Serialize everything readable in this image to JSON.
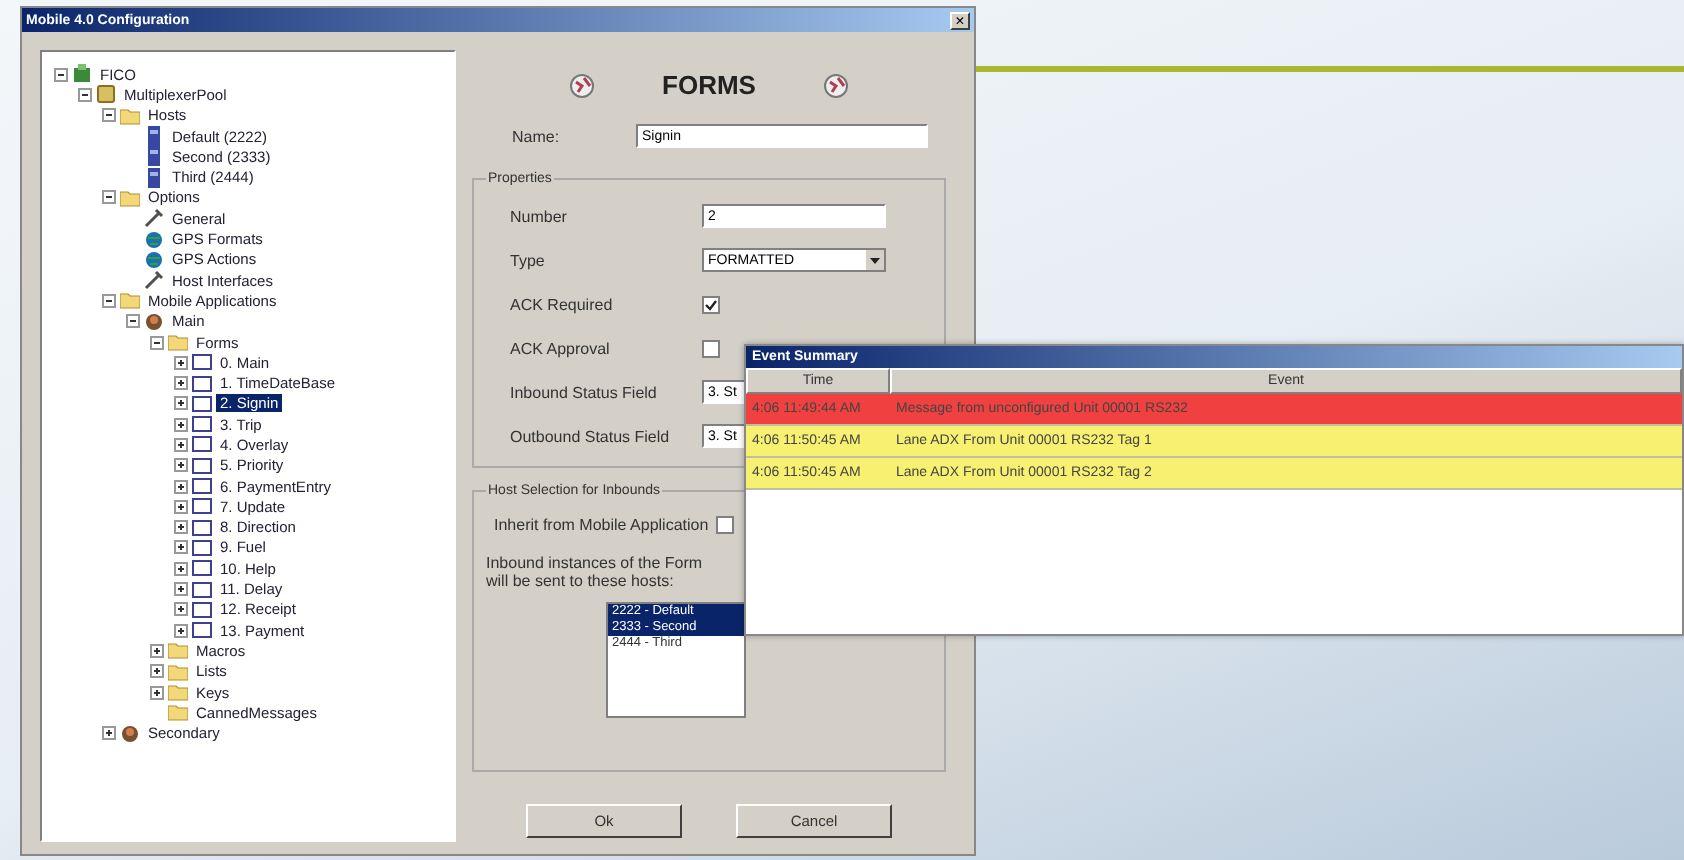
{
  "window": {
    "title": "Mobile 4.0 Configuration",
    "close": "×"
  },
  "tree": [
    {
      "label": "FICO",
      "kind": "root",
      "expanded": true,
      "selected": false,
      "children": [
        {
          "label": "MultiplexerPool",
          "kind": "pool",
          "expanded": true,
          "selected": false,
          "children": [
            {
              "label": "Hosts",
              "kind": "folder",
              "expanded": true,
              "selected": false,
              "children": [
                {
                  "label": "Default (2222)",
                  "kind": "host",
                  "selected": false
                },
                {
                  "label": "Second (2333)",
                  "kind": "host",
                  "selected": false
                },
                {
                  "label": "Third (2444)",
                  "kind": "host",
                  "selected": false
                }
              ]
            },
            {
              "label": "Options",
              "kind": "folder",
              "expanded": true,
              "selected": false,
              "children": [
                {
                  "label": "General",
                  "kind": "tool",
                  "selected": false
                },
                {
                  "label": "GPS Formats",
                  "kind": "gps",
                  "selected": false
                },
                {
                  "label": "GPS Actions",
                  "kind": "gps",
                  "selected": false
                },
                {
                  "label": "Host Interfaces",
                  "kind": "tool",
                  "selected": false
                }
              ]
            },
            {
              "label": "Mobile Applications",
              "kind": "folder",
              "expanded": true,
              "selected": false,
              "children": [
                {
                  "label": "Main",
                  "kind": "app",
                  "expanded": true,
                  "selected": false,
                  "children": [
                    {
                      "label": "Forms",
                      "kind": "folder",
                      "expanded": true,
                      "selected": false,
                      "children": [
                        {
                          "label": "0. Main",
                          "kind": "form",
                          "expanded": false,
                          "selected": false
                        },
                        {
                          "label": "1. TimeDateBase",
                          "kind": "form",
                          "expanded": false,
                          "selected": false
                        },
                        {
                          "label": "2. Signin",
                          "kind": "form",
                          "expanded": false,
                          "selected": true
                        },
                        {
                          "label": "3. Trip",
                          "kind": "form",
                          "expanded": false,
                          "selected": false
                        },
                        {
                          "label": "4. Overlay",
                          "kind": "form",
                          "expanded": false,
                          "selected": false
                        },
                        {
                          "label": "5. Priority",
                          "kind": "form",
                          "expanded": false,
                          "selected": false
                        },
                        {
                          "label": "6. PaymentEntry",
                          "kind": "form",
                          "expanded": false,
                          "selected": false
                        },
                        {
                          "label": "7. Update",
                          "kind": "form",
                          "expanded": false,
                          "selected": false
                        },
                        {
                          "label": "8. Direction",
                          "kind": "form",
                          "expanded": false,
                          "selected": false
                        },
                        {
                          "label": "9. Fuel",
                          "kind": "form",
                          "expanded": false,
                          "selected": false
                        },
                        {
                          "label": "10. Help",
                          "kind": "form",
                          "expanded": false,
                          "selected": false
                        },
                        {
                          "label": "11. Delay",
                          "kind": "form",
                          "expanded": false,
                          "selected": false
                        },
                        {
                          "label": "12. Receipt",
                          "kind": "form",
                          "expanded": false,
                          "selected": false
                        },
                        {
                          "label": "13. Payment",
                          "kind": "form",
                          "expanded": false,
                          "selected": false
                        }
                      ]
                    },
                    {
                      "label": "Macros",
                      "kind": "folder",
                      "expanded": false,
                      "selected": false
                    },
                    {
                      "label": "Lists",
                      "kind": "folder",
                      "expanded": false,
                      "selected": false
                    },
                    {
                      "label": "Keys",
                      "kind": "folder",
                      "expanded": false,
                      "selected": false
                    },
                    {
                      "label": "CannedMessages",
                      "kind": "folder",
                      "selected": false
                    }
                  ]
                }
              ]
            },
            {
              "label": "Secondary",
              "kind": "app",
              "expanded": false,
              "selected": false
            }
          ]
        }
      ]
    }
  ],
  "forms_panel": {
    "heading": "FORMS",
    "name_label": "Name:",
    "name_value": "Signin",
    "properties": {
      "title": "Properties",
      "number_label": "Number",
      "number_value": "2",
      "type_label": "Type",
      "type_value": "FORMATTED",
      "ack_required_label": "ACK Required",
      "ack_required": true,
      "ack_approval_label": "ACK Approval",
      "ack_approval": false,
      "inbound_status_label": "Inbound Status Field",
      "inbound_status_value": "3. St",
      "outbound_status_label": "Outbound Status Field",
      "outbound_status_value": "3. St"
    },
    "host_selection": {
      "title": "Host Selection for Inbounds",
      "inherit_label": "Inherit from Mobile Application",
      "inherit": false,
      "instances_text": "Inbound instances of the Form will be sent to these hosts:",
      "hosts": [
        {
          "label": "2222 - Default",
          "selected": true
        },
        {
          "label": "2333 - Second",
          "selected": true
        },
        {
          "label": "2444 - Third",
          "selected": false
        }
      ]
    },
    "buttons": [
      "Ok",
      "Cancel"
    ]
  },
  "event_summary": {
    "title": "Event Summary",
    "columns": [
      "Time",
      "Event"
    ],
    "rows": [
      {
        "time": "4:06 11:49:44 AM",
        "event": "Message from unconfigured Unit 00001 RS232",
        "color": "#f04040"
      },
      {
        "time": "4:06 11:50:45 AM",
        "event": "Lane ADX From Unit 00001 RS232 Tag 1",
        "color": "#f8f070"
      },
      {
        "time": "4:06 11:50:45 AM",
        "event": "Lane ADX From Unit 00001 RS232 Tag 2",
        "color": "#f8f070"
      }
    ]
  }
}
